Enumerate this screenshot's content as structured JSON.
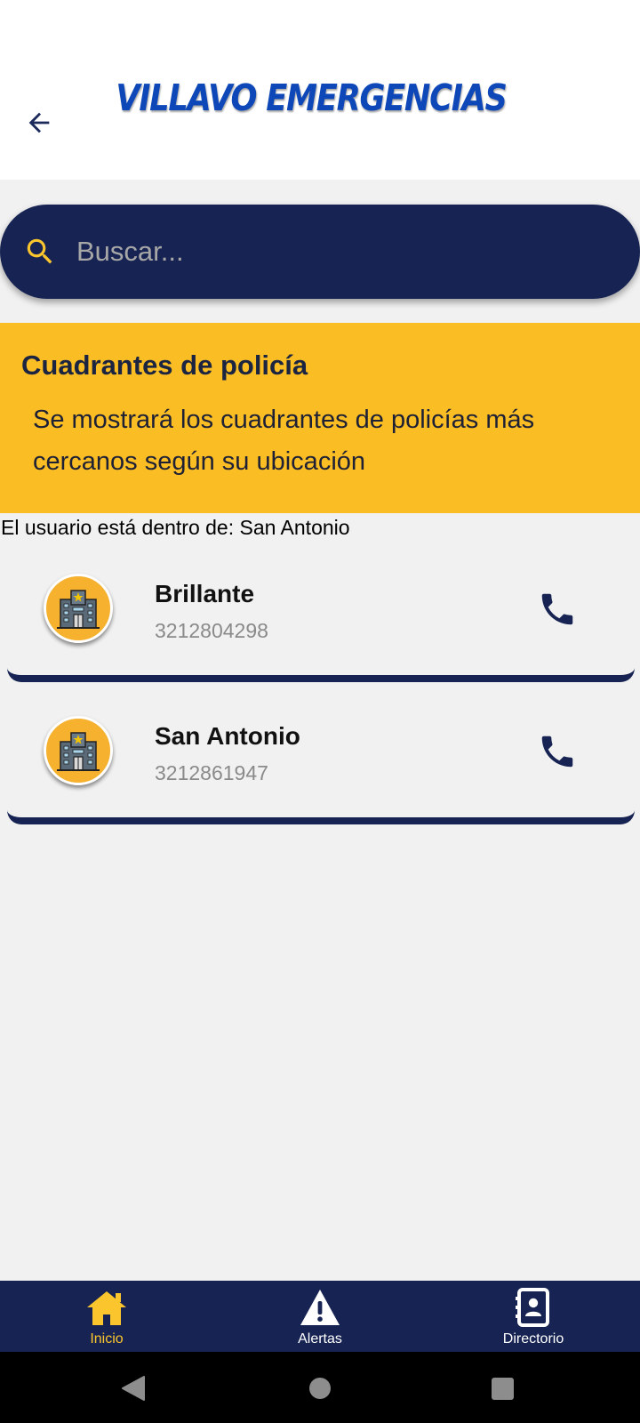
{
  "header": {
    "title": "VILLAVO EMERGENCIAS",
    "back_icon": "arrow-left-icon"
  },
  "search": {
    "placeholder": "Buscar...",
    "icon": "search-icon"
  },
  "info_card": {
    "title": "Cuadrantes de policía",
    "description": "Se mostrará los cuadrantes de policías más cercanos según su ubicación"
  },
  "location": {
    "text": "El usuario está dentro de: San Antonio"
  },
  "contacts": [
    {
      "name": "Brillante",
      "phone": "3212804298",
      "icon": "police-station-icon"
    },
    {
      "name": "San Antonio",
      "phone": "3212861947",
      "icon": "police-station-icon"
    }
  ],
  "bottom_nav": {
    "items": [
      {
        "label": "Inicio",
        "icon": "home-icon",
        "active": true
      },
      {
        "label": "Alertas",
        "icon": "warning-icon",
        "active": false
      },
      {
        "label": "Directorio",
        "icon": "contacts-book-icon",
        "active": false
      }
    ]
  },
  "colors": {
    "primary_navy": "#172453",
    "accent_yellow": "#fabd24",
    "title_blue": "#0d47b8",
    "background": "#f1f1f1"
  }
}
